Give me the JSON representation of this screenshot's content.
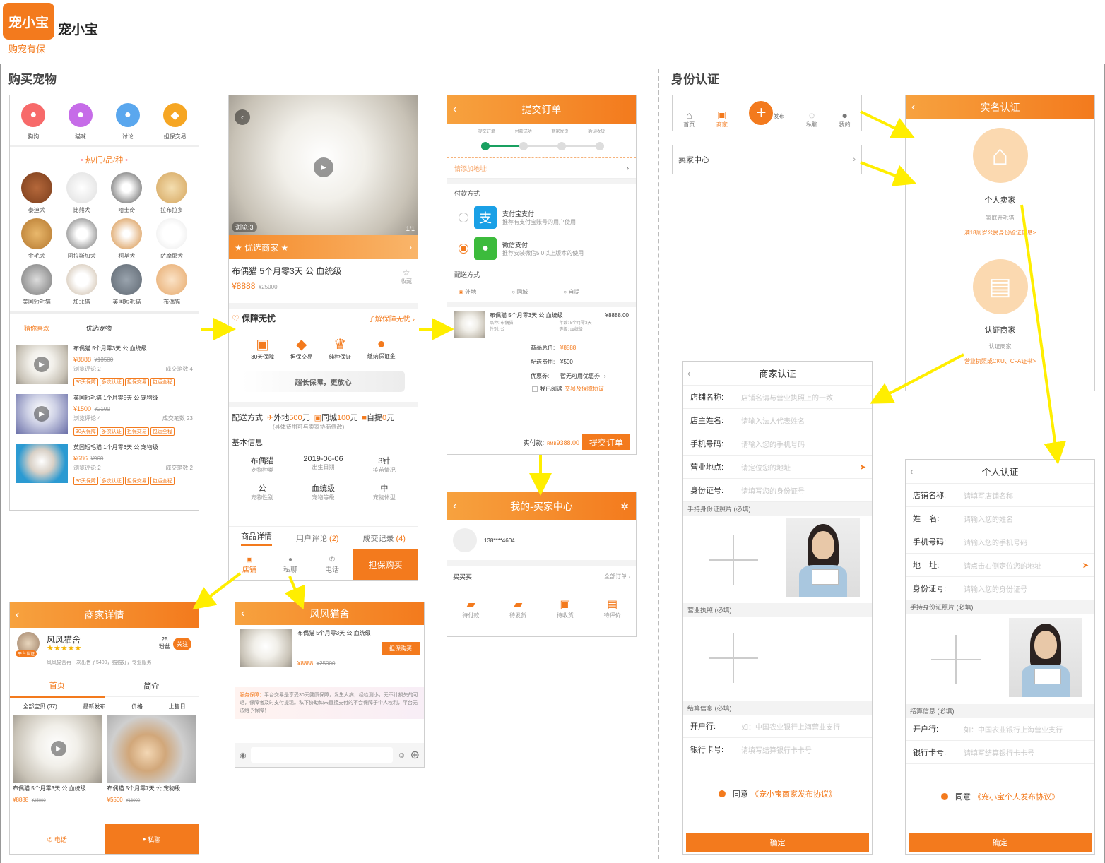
{
  "brand": {
    "logo_text": "宠小宝",
    "name": "宠小宝",
    "slogan": "购宠有保"
  },
  "sections": {
    "buy": "购买宠物",
    "identity": "身份认证"
  },
  "home": {
    "top_icons": [
      {
        "label": "狗狗",
        "icon": "dog-icon",
        "color": "#f76a6a"
      },
      {
        "label": "猫咪",
        "icon": "cat-icon",
        "color": "#c66ce8"
      },
      {
        "label": "讨论",
        "icon": "user-icon",
        "color": "#5aa7ee"
      },
      {
        "label": "担保交易",
        "icon": "shield-icon",
        "color": "#f6a623"
      }
    ],
    "hot_title": "热/门/品/种",
    "breeds": [
      "泰迪犬",
      "比熊犬",
      "哈士奇",
      "拉布拉多",
      "金毛犬",
      "阿拉斯加犬",
      "柯基犬",
      "萨摩耶犬",
      "美国短毛猫",
      "加菲猫",
      "英国短毛猫",
      "布偶猫"
    ],
    "tabs": [
      "猜你喜欢",
      "优选宠物"
    ],
    "products": [
      {
        "title": "布偶猫 5个月零3天 公 血统级",
        "price": "¥8888",
        "old": "¥13500",
        "views": "浏览评论 2",
        "deals": "成交笔数 4"
      },
      {
        "title": "英国短毛猫 1个月零5天 公 宠物级",
        "price": "¥1500",
        "old": "¥2100",
        "views": "浏览评论 4",
        "deals": "成交笔数 23"
      },
      {
        "title": "英国短毛猫 1个月零6天 公 宠物级",
        "price": "¥686",
        "old": "¥960",
        "views": "浏览评论 2",
        "deals": "成交笔数 2"
      }
    ],
    "tags": [
      "30天保障",
      "多次认证",
      "担保交易",
      "包运全程"
    ]
  },
  "detail": {
    "views": "浏览:3",
    "page": "1/1",
    "featured": "优选商家",
    "title": "布偶猫 5个月零3天 公 血统级",
    "price": "¥8888",
    "old_price": "¥25000",
    "fav": "收藏",
    "guarantee": "保障无忧",
    "learn": "了解保障无忧",
    "g_items": [
      "30天保障",
      "担保交易",
      "纯种保证",
      "缴纳保证金"
    ],
    "banner": "超长保障，更放心",
    "delivery_label": "配送方式",
    "delivery": [
      {
        "name": "外地",
        "fee": "500",
        "unit": "元"
      },
      {
        "name": "同城",
        "fee": "100",
        "unit": "元"
      },
      {
        "name": "自提",
        "fee": "0",
        "unit": "元"
      }
    ],
    "delivery_note": "(具体费用可与卖家协商修改)",
    "basic_info": "基本信息",
    "info": [
      {
        "v": "布偶猫",
        "k": "宠物种类"
      },
      {
        "v": "2019-06-06",
        "k": "出生日期"
      },
      {
        "v": "3针",
        "k": "疫苗情况"
      },
      {
        "v": "公",
        "k": "宠物性别"
      },
      {
        "v": "血统级",
        "k": "宠物等级"
      },
      {
        "v": "中",
        "k": "宠物体型"
      }
    ],
    "tabs": [
      "商品详情",
      "用户评论",
      "(2)",
      "成交记录",
      "(4)"
    ],
    "bottom": [
      "店铺",
      "私聊",
      "电话"
    ],
    "buy": "担保购买"
  },
  "order": {
    "title": "提交订单",
    "steps": [
      "提交订单",
      "付款成功",
      "商家发货",
      "确认收货"
    ],
    "address": "请添加地址!",
    "pay_label": "付款方式",
    "pays": [
      {
        "name": "支付宝支付",
        "desc": "推荐有支付宝账号的用户使用"
      },
      {
        "name": "微信支付",
        "desc": "推荐安装微信5.0以上版本的使用"
      }
    ],
    "ship_label": "配送方式",
    "ships": [
      "外地",
      "同城",
      "自提"
    ],
    "item_title": "布偶猫 5个月零3天 公 血统级",
    "item_price": "¥8888.00",
    "item_meta": [
      "品种: 布偶猫",
      "年龄: 5个月零3天",
      "性别: 公",
      "等级: 血统级"
    ],
    "lines": [
      {
        "k": "商品总价:",
        "v": "¥8888"
      },
      {
        "k": "配送费用:",
        "v": "¥500"
      },
      {
        "k": "优惠券:",
        "v": "暂无可用优惠券"
      }
    ],
    "agree": "我已阅读",
    "agree_link": "交易及保障协议",
    "paid_label": "实付款:",
    "paid_prefix": "RMB",
    "paid": "9388.00",
    "submit": "提交订单"
  },
  "buyer": {
    "title": "我的-买家中心",
    "phone": "138****4604",
    "buy": "买买买",
    "all": "全部订单",
    "items": [
      "待付款",
      "待发货",
      "待收货",
      "待评价"
    ]
  },
  "shop": {
    "title": "商家详情",
    "name": "风风猫舍",
    "badge": "平台认证",
    "fans_num": "25",
    "fans": "粉丝",
    "follow": "关注",
    "desc": "风风猫舍再一次出售了5400，猫猫好，专业服务",
    "tabs": [
      "首页",
      "简介"
    ],
    "filters": [
      "全部宝贝 (37)",
      "最新发布",
      "价格",
      "上售日"
    ],
    "items": [
      {
        "title": "布偶猫 5个月零3天 公 血统级",
        "price": "¥8888",
        "old": "¥25000"
      },
      {
        "title": "布偶猫 5个月零7天 公 宠物级",
        "price": "¥5500",
        "old": "¥13000"
      }
    ],
    "call": "电话",
    "chat": "私聊"
  },
  "chat": {
    "title": "风风猫舍",
    "item": "布偶猫 5个月零3天 公 血统级",
    "price": "¥8888",
    "old": "¥25000",
    "buy": "担保购买",
    "notice_label": "服务保障：",
    "notice": "平台交易是享受30天健康保障，发生大病，经检测小，无不计损失的可退，保障者及时支付提现。私下协助如未直接支付的不会保障于个人权利，平台无法给予保障！"
  },
  "identity": {
    "nav": [
      "首页",
      "商家",
      "发布",
      "私聊",
      "我的"
    ],
    "seller_center": "卖家中心",
    "real": {
      "title": "实名认证",
      "personal": "个人卖家",
      "personal_sub": "家庭开毛猫",
      "personal_req": "满18周岁公民身份验证信息>",
      "merchant": "认证商家",
      "merchant_sub": "认证商家",
      "merchant_req": "营业执照或CKU、CFA证书>"
    },
    "merchant_form": {
      "title": "商家认证",
      "fields": [
        {
          "k": "店铺名称:",
          "p": "店铺名请与营业执照上的一致"
        },
        {
          "k": "店主姓名:",
          "p": "请输入法人代表姓名"
        },
        {
          "k": "手机号码:",
          "p": "请输入您的手机号码"
        },
        {
          "k": "营业地点:",
          "p": "请定位您的地址"
        },
        {
          "k": "身份证号:",
          "p": "请填写您的身份证号"
        }
      ],
      "photo_label": "手持身份证照片 (必填)",
      "license_label": "营业执照 (必填)",
      "settle_label": "结算信息 (必填)",
      "bank": [
        {
          "k": "开户行:",
          "p": "如：中国农业银行上海营业支行"
        },
        {
          "k": "银行卡号:",
          "p": "请填写结算银行卡卡号"
        }
      ],
      "agree": "同意",
      "agree_link": "《宠小宝商家发布协议》",
      "confirm": "确定"
    },
    "personal_form": {
      "title": "个人认证",
      "fields": [
        {
          "k": "店铺名称:",
          "p": "请填写店铺名称"
        },
        {
          "k": "姓    名:",
          "p": "请输入您的姓名"
        },
        {
          "k": "手机号码:",
          "p": "请输入您的手机号码"
        },
        {
          "k": "地    址:",
          "p": "请点击右侧定位您的地址"
        },
        {
          "k": "身份证号:",
          "p": "请输入您的身份证号"
        }
      ],
      "photo_label": "手持身份证照片 (必填)",
      "settle_label": "结算信息 (必填)",
      "bank": [
        {
          "k": "开户行:",
          "p": "如：中国农业银行上海营业支行"
        },
        {
          "k": "银行卡号:",
          "p": "请填写结算银行卡卡号"
        }
      ],
      "agree": "同意",
      "agree_link": "《宠小宝个人发布协议》",
      "confirm": "确定"
    }
  },
  "colors": {
    "orange": "#f37a1d",
    "arrow": "#ffee00"
  }
}
